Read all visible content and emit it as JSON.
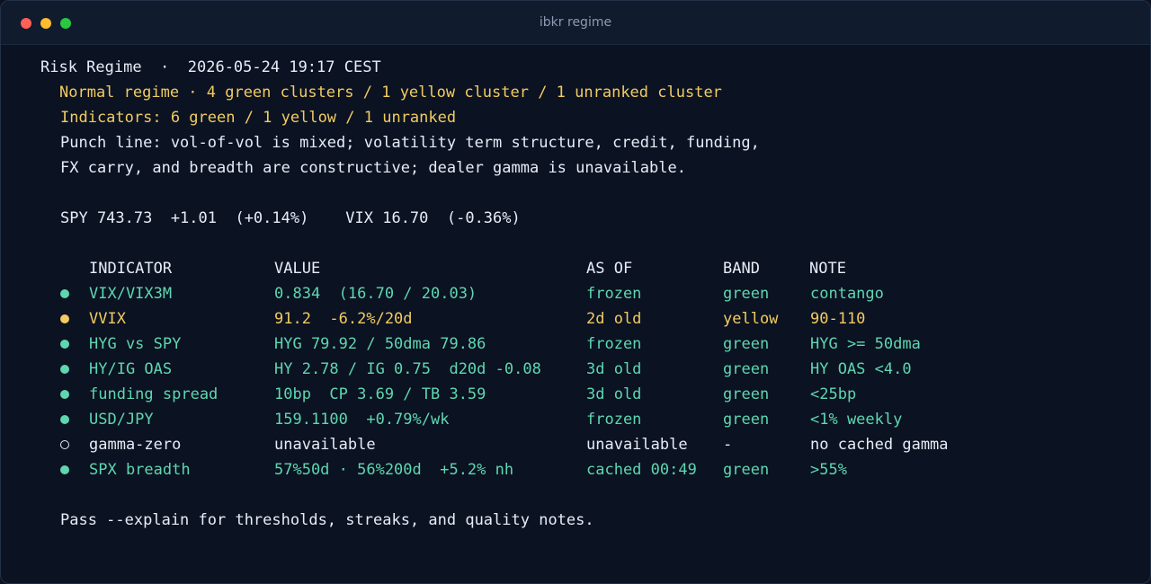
{
  "window": {
    "title": "ibkr regime"
  },
  "header": {
    "line": "Risk Regime  ·  2026-05-24 19:17 CEST",
    "regime": "Normal regime · 4 green clusters / 1 yellow cluster / 1 unranked cluster",
    "indicators": "Indicators: 6 green / 1 yellow / 1 unranked",
    "punch1": "Punch line: vol-of-vol is mixed; volatility term structure, credit, funding,",
    "punch2": "FX carry, and breadth are constructive; dealer gamma is unavailable.",
    "quotes": "SPY 743.73  +1.01  (+0.14%)    VIX 16.70  (-0.36%)"
  },
  "table": {
    "headers": [
      "INDICATOR",
      "VALUE",
      "AS OF",
      "BAND",
      "NOTE"
    ],
    "rows": [
      {
        "status": "green",
        "indicator": "VIX/VIX3M",
        "value": "0.834  (16.70 / 20.03)",
        "as_of": "frozen",
        "band": "green",
        "note": "contango"
      },
      {
        "status": "yellow",
        "indicator": "VVIX",
        "value": "91.2  -6.2%/20d",
        "as_of": "2d old",
        "band": "yellow",
        "note": "90-110"
      },
      {
        "status": "green",
        "indicator": "HYG vs SPY",
        "value": "HYG 79.92 / 50dma 79.86",
        "as_of": "frozen",
        "band": "green",
        "note": "HYG >= 50dma"
      },
      {
        "status": "green",
        "indicator": "HY/IG OAS",
        "value": "HY 2.78 / IG 0.75  d20d -0.08",
        "as_of": "3d old",
        "band": "green",
        "note": "HY OAS <4.0"
      },
      {
        "status": "green",
        "indicator": "funding spread",
        "value": "10bp  CP 3.69 / TB 3.59",
        "as_of": "3d old",
        "band": "green",
        "note": "<25bp"
      },
      {
        "status": "green",
        "indicator": "USD/JPY",
        "value": "159.1100  +0.79%/wk",
        "as_of": "frozen",
        "band": "green",
        "note": "<1% weekly"
      },
      {
        "status": "unranked",
        "indicator": "gamma-zero",
        "value": "unavailable",
        "as_of": "unavailable",
        "band": "-",
        "note": "no cached gamma"
      },
      {
        "status": "green",
        "indicator": "SPX breadth",
        "value": "57%50d · 56%200d  +5.2% nh",
        "as_of": "cached 00:49",
        "band": "green",
        "note": ">55%"
      }
    ]
  },
  "footer": {
    "hint": "Pass --explain for thresholds, streaks, and quality notes."
  },
  "colors": {
    "green": "#5ed7b0",
    "yellow": "#f2cc60",
    "white": "#e6edf7",
    "background": "#0b1222"
  }
}
